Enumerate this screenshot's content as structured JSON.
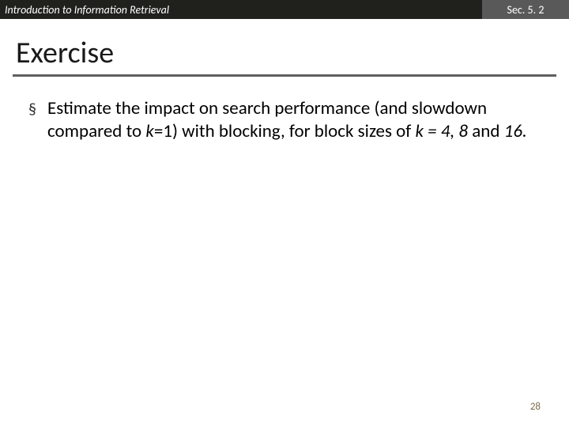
{
  "header": {
    "course_title": "Introduction to Information Retrieval",
    "section_label": "Sec. 5. 2"
  },
  "slide": {
    "title": "Exercise",
    "bullet_marker": "§",
    "bullet_text_1": "Estimate the impact on search performance (and slowdown compared to ",
    "bullet_text_k1_k": "k",
    "bullet_text_k1_eq": "=1) with blocking, for block sizes of ",
    "bullet_text_kvals_k": "k",
    "bullet_text_kvals": " = 4, 8 ",
    "bullet_text_and": "and ",
    "bullet_text_16": "16.",
    "page_number": "28"
  }
}
